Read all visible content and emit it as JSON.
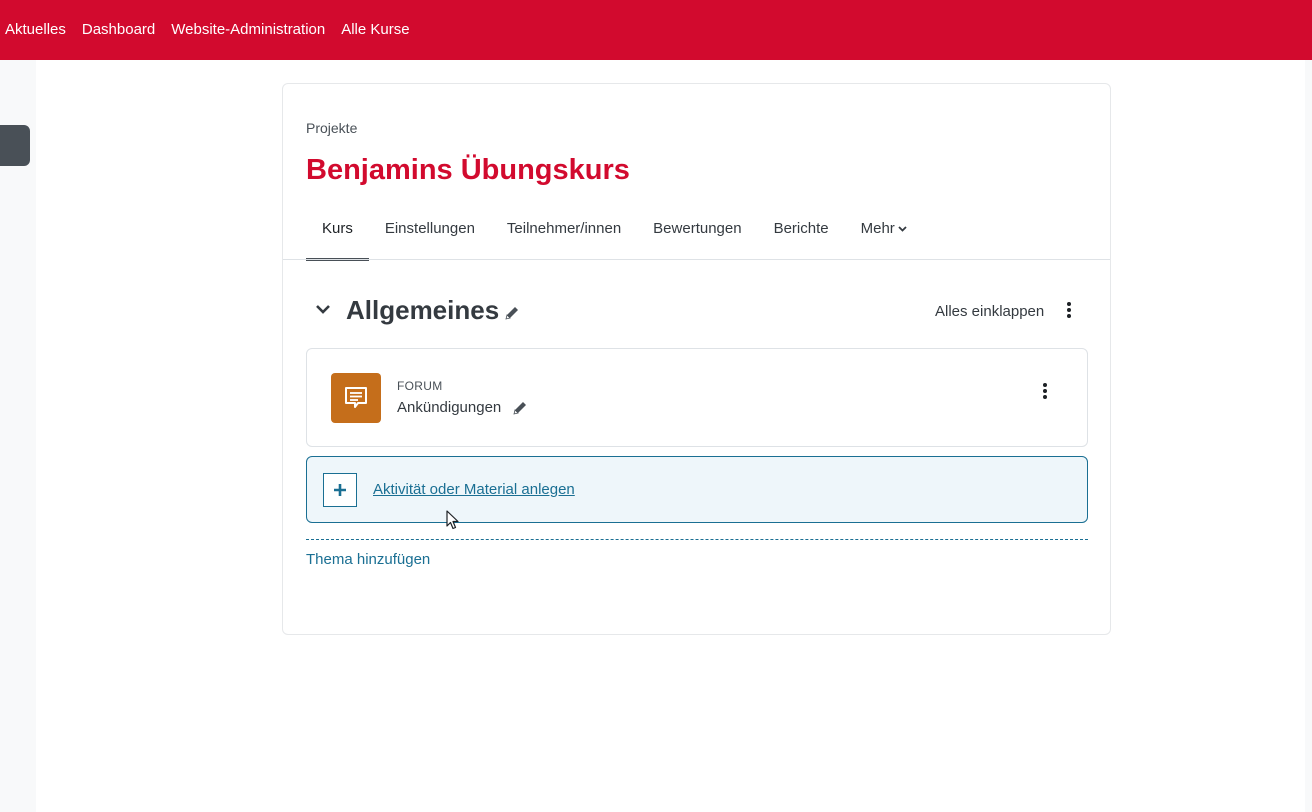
{
  "nav": {
    "items": [
      "Aktuelles",
      "Dashboard",
      "Website-Administration",
      "Alle Kurse"
    ]
  },
  "header": {
    "category": "Projekte",
    "course_title": "Benjamins Übungskurs"
  },
  "tabs": [
    {
      "label": "Kurs",
      "active": true
    },
    {
      "label": "Einstellungen",
      "active": false
    },
    {
      "label": "Teilnehmer/innen",
      "active": false
    },
    {
      "label": "Bewertungen",
      "active": false
    },
    {
      "label": "Berichte",
      "active": false
    },
    {
      "label": "Mehr",
      "active": false
    }
  ],
  "section": {
    "title": "Allgemeines",
    "collapse_all_label": "Alles einklappen"
  },
  "activity": {
    "type": "FORUM",
    "name": "Ankündigungen",
    "icon": "forum-icon",
    "icon_color": "#c56e1b"
  },
  "add_activity": {
    "label": "Aktivität oder Material anlegen"
  },
  "add_section": {
    "label": "Thema hinzufügen"
  },
  "colors": {
    "brand": "#d20a2e",
    "link": "#1a6f93"
  }
}
